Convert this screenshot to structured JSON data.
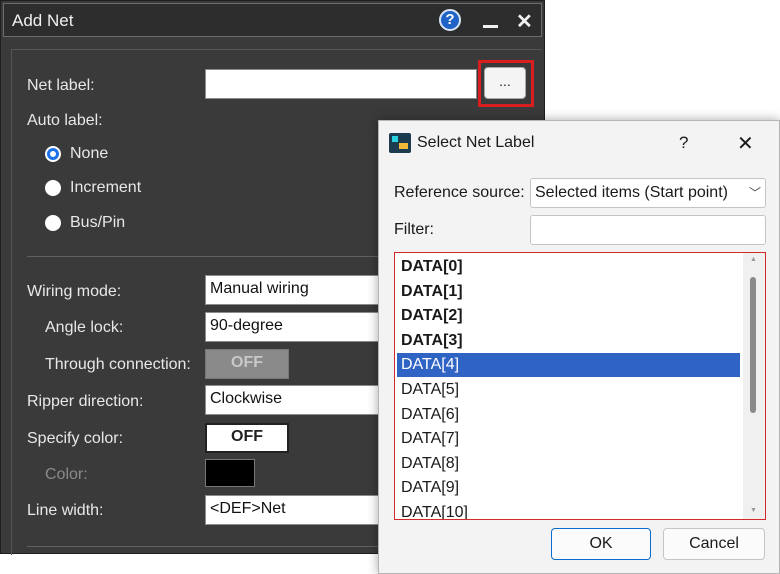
{
  "add_net": {
    "title": "Add Net",
    "help_glyph": "?",
    "close_glyph": "✕",
    "net_label": {
      "label": "Net label:",
      "value": "",
      "browse_label": "..."
    },
    "auto_label": {
      "label": "Auto label:",
      "options": [
        {
          "label": "None",
          "selected": true
        },
        {
          "label": "Increment",
          "selected": false
        },
        {
          "label": "Bus/Pin",
          "selected": false
        }
      ]
    },
    "wiring_mode": {
      "label": "Wiring mode:",
      "value": "Manual wiring"
    },
    "angle_lock": {
      "label": "Angle lock:",
      "value": "90-degree"
    },
    "through_connection": {
      "label": "Through connection:",
      "value": "OFF"
    },
    "ripper_direction": {
      "label": "Ripper direction:",
      "value": "Clockwise"
    },
    "specify_color": {
      "label": "Specify color:",
      "value": "OFF"
    },
    "color": {
      "label": "Color:",
      "swatch": "#000000"
    },
    "line_width": {
      "label": "Line width:",
      "value": "<DEF>Net"
    }
  },
  "select_net_label": {
    "title": "Select Net Label",
    "help_glyph": "?",
    "close_glyph": "✕",
    "reference_source": {
      "label": "Reference source:",
      "value": "Selected items (Start point)",
      "chevron": "﹀"
    },
    "filter": {
      "label": "Filter:",
      "value": ""
    },
    "items": [
      {
        "label": "DATA[0]",
        "bold": true,
        "selected": false
      },
      {
        "label": "DATA[1]",
        "bold": true,
        "selected": false
      },
      {
        "label": "DATA[2]",
        "bold": true,
        "selected": false
      },
      {
        "label": "DATA[3]",
        "bold": true,
        "selected": false
      },
      {
        "label": "DATA[4]",
        "bold": false,
        "selected": true
      },
      {
        "label": "DATA[5]",
        "bold": false,
        "selected": false
      },
      {
        "label": "DATA[6]",
        "bold": false,
        "selected": false
      },
      {
        "label": "DATA[7]",
        "bold": false,
        "selected": false
      },
      {
        "label": "DATA[8]",
        "bold": false,
        "selected": false
      },
      {
        "label": "DATA[9]",
        "bold": false,
        "selected": false
      },
      {
        "label": "DATA[10]",
        "bold": false,
        "selected": false
      }
    ],
    "ok_label": "OK",
    "cancel_label": "Cancel"
  },
  "colors": {
    "accent": "#2f63c4",
    "highlight": "#d81f1f",
    "dark_bg": "#3a3a3a"
  }
}
